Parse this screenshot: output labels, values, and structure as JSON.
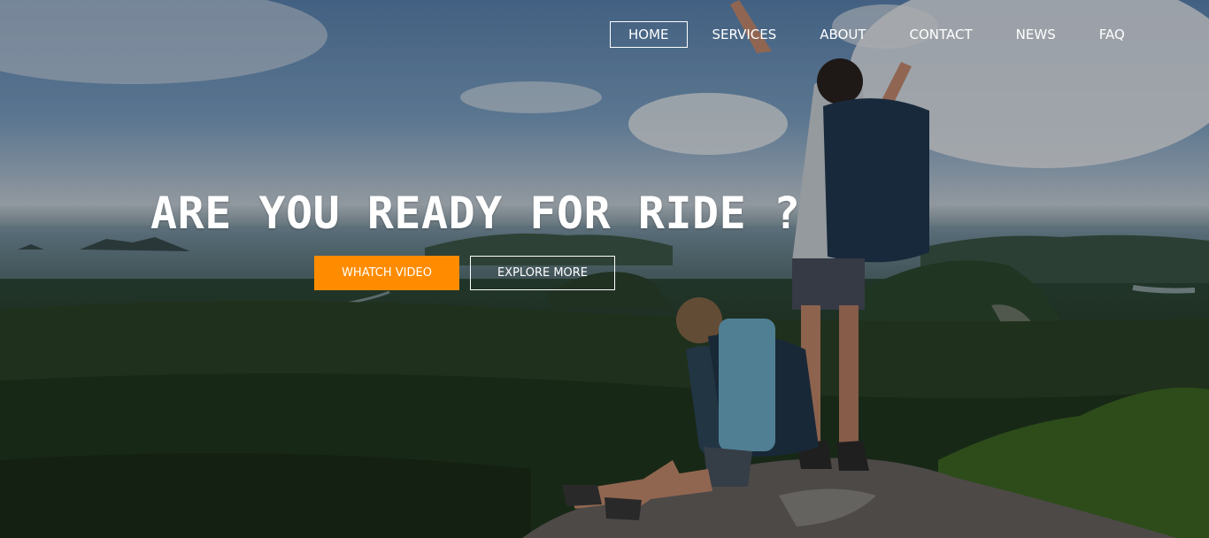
{
  "nav": {
    "items": [
      {
        "label": "HOME",
        "active": true
      },
      {
        "label": "SERVICES",
        "active": false
      },
      {
        "label": "ABOUT",
        "active": false
      },
      {
        "label": "CONTACT",
        "active": false
      },
      {
        "label": "NEWS",
        "active": false
      },
      {
        "label": "FAQ",
        "active": false
      }
    ]
  },
  "hero": {
    "headline": "ARE YOU READY FOR RIDE ?",
    "primary_button": "WHATCH VIDEO",
    "secondary_button": "EXPLORE MORE"
  },
  "colors": {
    "accent": "#ff8c00",
    "text": "#ffffff"
  }
}
